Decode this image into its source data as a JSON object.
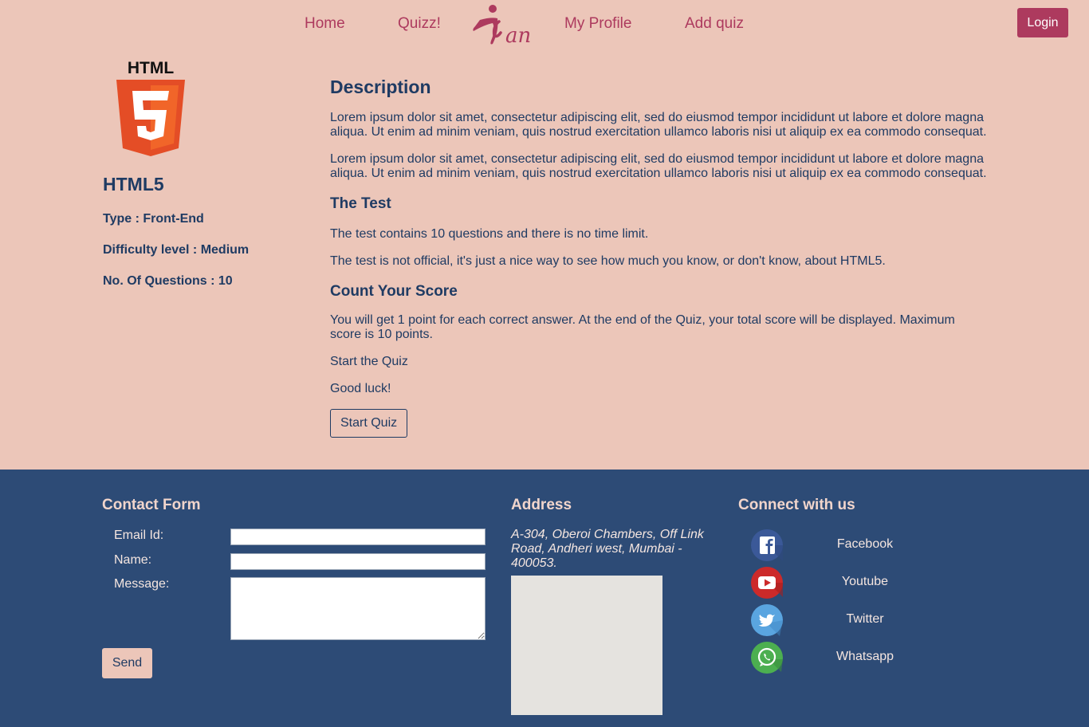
{
  "nav": {
    "items": [
      {
        "label": "Home"
      },
      {
        "label": "Quizz!"
      },
      {
        "label": "My Profile"
      },
      {
        "label": "Add quiz"
      }
    ],
    "login_label": "Login",
    "logo_text": "Kan"
  },
  "quiz": {
    "logo_text": "HTML",
    "name": "HTML5",
    "type": "Type : Front-End",
    "difficulty": "Difficulty level : Medium",
    "questions": "No. Of Questions : 10"
  },
  "description": {
    "heading": "Description",
    "paragraphs": [
      "Lorem ipsum dolor sit amet, consectetur adipiscing elit, sed do eiusmod tempor incididunt ut labore et dolore magna aliqua. Ut enim ad minim veniam, quis nostrud exercitation ullamco laboris nisi ut aliquip ex ea commodo consequat.",
      "Lorem ipsum dolor sit amet, consectetur adipiscing elit, sed do eiusmod tempor incididunt ut labore et dolore magna aliqua. Ut enim ad minim veniam, quis nostrud exercitation ullamco laboris nisi ut aliquip ex ea commodo consequat."
    ],
    "test_heading": "The Test",
    "test_lines": [
      "The test contains 10 questions and there is no time limit.",
      "The test is not official, it's just a nice way to see how much you know, or don't know, about HTML5."
    ],
    "score_heading": "Count Your Score",
    "score_lines": [
      "You will get 1 point for each correct answer. At the end of the Quiz, your total score will be displayed. Maximum score is 10 points.",
      "Start the Quiz",
      "Good luck!"
    ],
    "start_button": "Start Quiz"
  },
  "footer": {
    "contact_heading": "Contact Form",
    "email_label": "Email Id:",
    "name_label": "Name:",
    "message_label": "Message:",
    "email_value": "",
    "name_value": "",
    "message_value": "",
    "send_label": "Send",
    "address_heading": "Address",
    "address_text": "A-304, Oberoi Chambers, Off Link Road, Andheri west, Mumbai - 400053.",
    "connect_heading": "Connect with us",
    "social": [
      {
        "label": "Facebook",
        "icon": "facebook-icon",
        "color": "#3b5998"
      },
      {
        "label": "Youtube",
        "icon": "youtube-icon",
        "color": "#cc2a2a"
      },
      {
        "label": "Twitter",
        "icon": "twitter-icon",
        "color": "#5aa5e0"
      },
      {
        "label": "Whatsapp",
        "icon": "whatsapp-icon",
        "color": "#4caf50"
      }
    ]
  },
  "colors": {
    "page_bg": "#ecc6b9",
    "accent": "#ad3a5e",
    "text": "#1f3b63",
    "footer_bg": "#2d4b76",
    "html5_orange": "#e44d26"
  }
}
